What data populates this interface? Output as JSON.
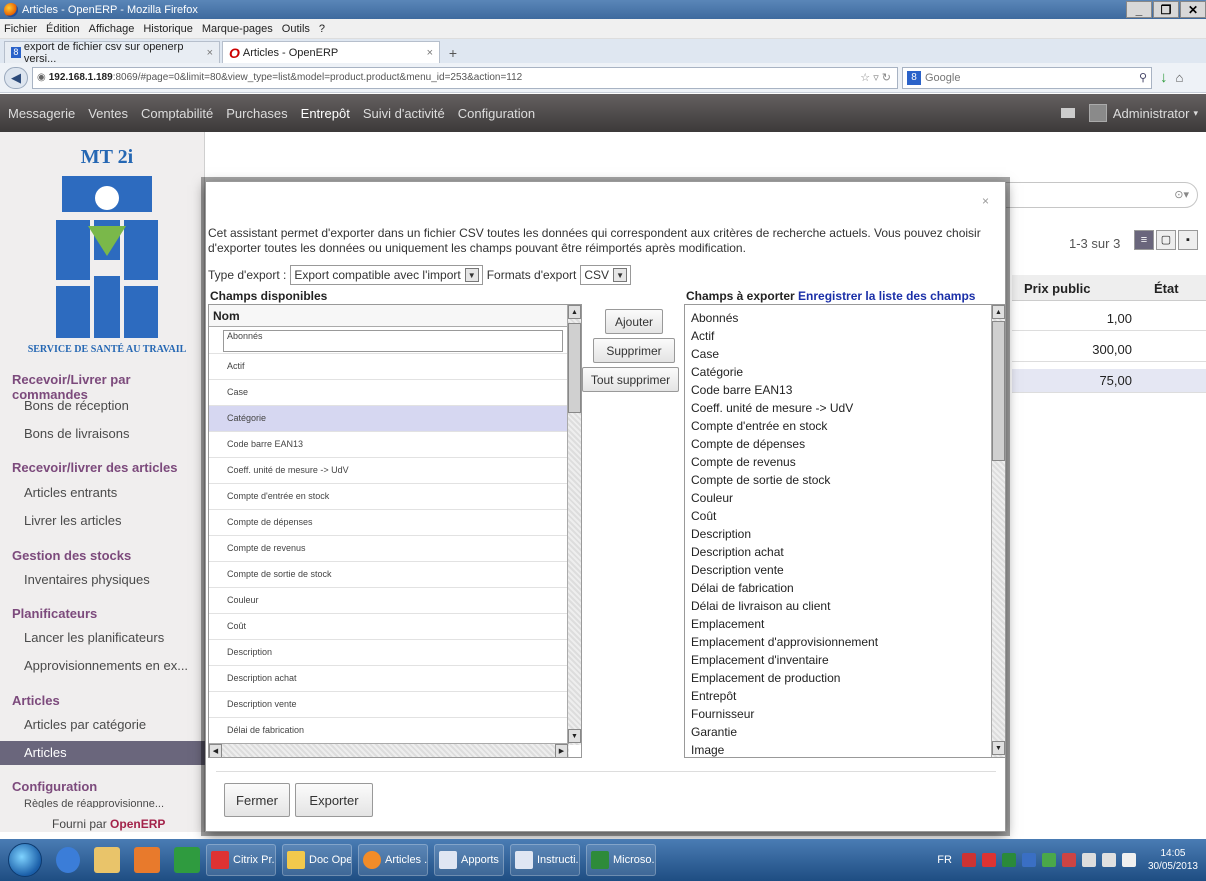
{
  "browser": {
    "window_title": "Articles - OpenERP - Mozilla Firefox",
    "menu": [
      "Fichier",
      "Édition",
      "Affichage",
      "Historique",
      "Marque-pages",
      "Outils",
      "?"
    ],
    "tabs": [
      {
        "label": "export de fichier csv sur openerp versi..."
      },
      {
        "label": "Articles - OpenERP"
      }
    ],
    "url_host": "192.168.1.189",
    "url_rest": ":8069/#page=0&limit=80&view_type=list&model=product.product&menu_id=253&action=112",
    "search_engine": "Google"
  },
  "oe": {
    "top_menu": [
      "Messagerie",
      "Ventes",
      "Comptabilité",
      "Purchases",
      "Entrepôt",
      "Suivi d'activité",
      "Configuration"
    ],
    "active_menu": "Entrepôt",
    "user": "Administrator",
    "logo_title": "MT 2i",
    "logo_caption": "SERVICE DE SANTÉ AU TRAVAIL",
    "sidebar": {
      "sec1": "Recevoir/Livrer par commandes",
      "sec1_items": [
        "Bons de réception",
        "Bons de livraisons"
      ],
      "sec2": "Recevoir/livrer des articles",
      "sec2_items": [
        "Articles entrants",
        "Livrer les articles"
      ],
      "sec3": "Gestion des stocks",
      "sec3_items": [
        "Inventaires physiques"
      ],
      "sec4": "Planificateurs",
      "sec4_items": [
        "Lancer les planificateurs",
        "Approvisionnements en ex..."
      ],
      "sec5": "Articles",
      "sec5_items": [
        "Articles par catégorie",
        "Articles"
      ],
      "sec6": "Configuration",
      "sec6_items": [
        "Règles de réapprovisionne..."
      ],
      "powered_prefix": "Fourni par",
      "powered_brand": "OpenERP"
    },
    "list": {
      "pager": "1-3 sur 3",
      "col_price": "Prix public",
      "col_state": "État",
      "prices": [
        "1,00",
        "300,00",
        "75,00"
      ]
    }
  },
  "dialog": {
    "close": "×",
    "intro": "Cet assistant permet d'exporter dans un fichier CSV toutes les données qui correspondent aux critères de recherche actuels. Vous pouvez choisir d'exporter toutes les données ou uniquement les champs pouvant être réimportés après modification.",
    "export_type_label": "Type d'export :",
    "export_type_value": "Export compatible avec l'import",
    "format_label": "Formats d'export",
    "format_value": "CSV",
    "available_title": "Champs disponibles",
    "available_header": "Nom",
    "available_fields": [
      "Abonnés",
      "Actif",
      "Case",
      "Catégorie",
      "Code barre EAN13",
      "Coeff. unité de mesure -> UdV",
      "Compte d'entrée en stock",
      "Compte de dépenses",
      "Compte de revenus",
      "Compte de sortie de stock",
      "Couleur",
      "Coût",
      "Description",
      "Description achat",
      "Description vente",
      "Délai de fabrication"
    ],
    "btn_add": "Ajouter",
    "btn_remove": "Supprimer",
    "btn_remove_all": "Tout supprimer",
    "export_title": "Champs à exporter",
    "save_list_link": "Enregistrer la liste des champs",
    "export_fields": [
      "Abonnés",
      "Actif",
      "Case",
      "Catégorie",
      "Code barre EAN13",
      "Coeff. unité de mesure -> UdV",
      "Compte d'entrée en stock",
      "Compte de dépenses",
      "Compte de revenus",
      "Compte de sortie de stock",
      "Couleur",
      "Coût",
      "Description",
      "Description achat",
      "Description vente",
      "Délai de fabrication",
      "Délai de livraison au client",
      "Emplacement",
      "Emplacement d'approvisionnement",
      "Emplacement d'inventaire",
      "Emplacement de production",
      "Entrepôt",
      "Fournisseur",
      "Garantie",
      "Image"
    ],
    "btn_close": "Fermer",
    "btn_export": "Exporter"
  },
  "taskbar": {
    "items": [
      "Citrix Pr...",
      "Doc Ope...",
      "Articles ...",
      "Apports ...",
      "Instructi...",
      "Microso..."
    ],
    "lang": "FR",
    "time": "14:05",
    "date": "30/05/2013"
  },
  "colors": {
    "sidebar_section": "#7c4a7c",
    "active_menu_bg": "#6a667c",
    "link": "#1a2fa8",
    "brand": "#a3234a"
  }
}
